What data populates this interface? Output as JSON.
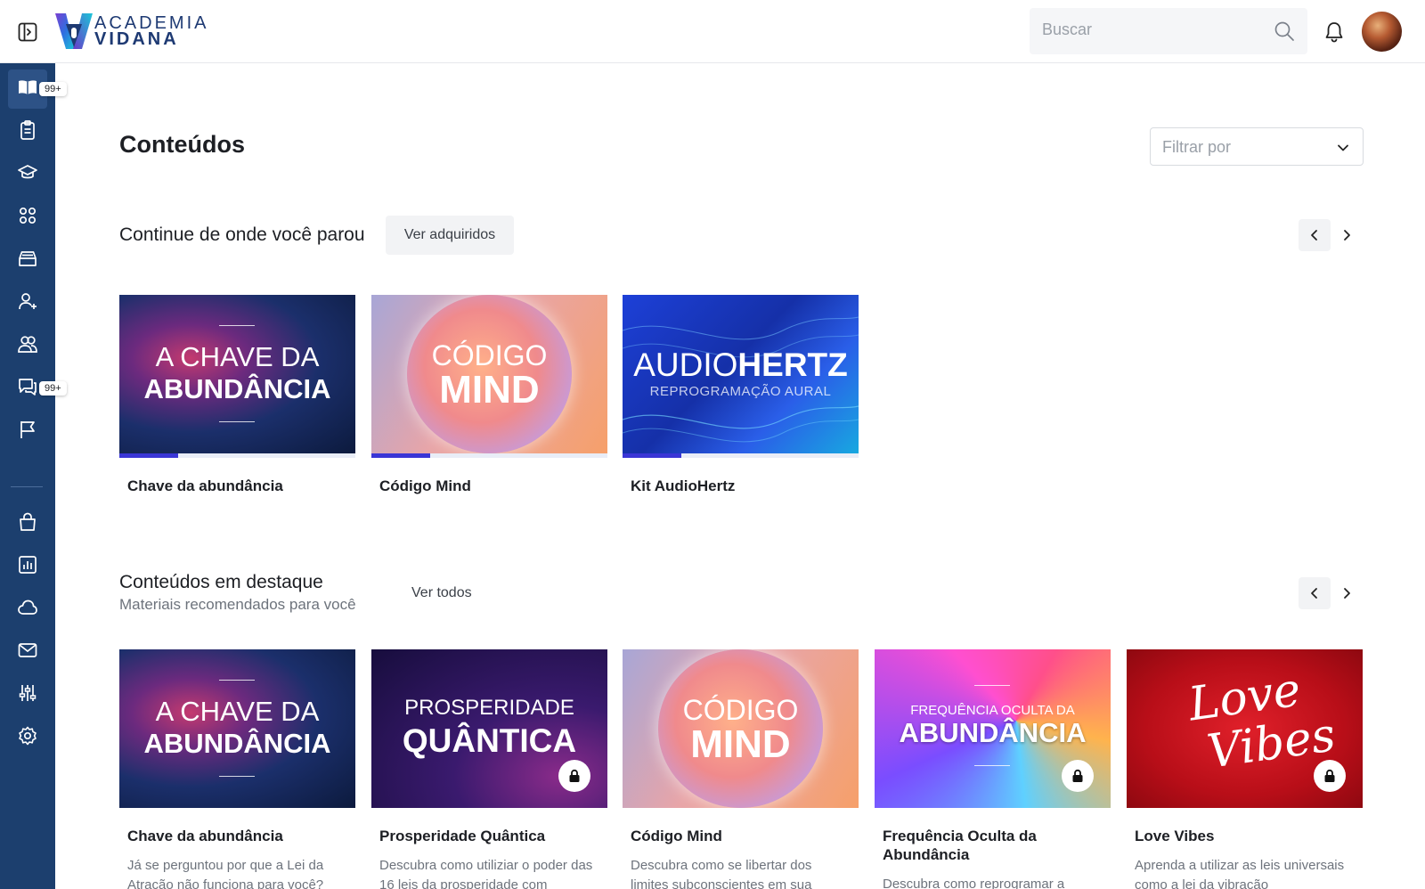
{
  "header": {
    "logo_line1": "ACADEMIA",
    "logo_line2": "VIDANA",
    "search_placeholder": "Buscar"
  },
  "sidebar": {
    "badges": {
      "contents": "99+",
      "messages": "99+"
    }
  },
  "main": {
    "title": "Conteúdos",
    "filter_placeholder": "Filtrar por",
    "continue": {
      "title": "Continue de onde você parou",
      "button": "Ver adquiridos",
      "items": [
        {
          "title": "Chave da abundância",
          "progress": 0.25,
          "art_line1": "A CHAVE DA",
          "art_line2": "ABUNDÂNCIA"
        },
        {
          "title": "Código Mind",
          "progress": 0.25,
          "art_line1": "CÓDIGO",
          "art_line2": "MIND"
        },
        {
          "title": "Kit AudioHertz",
          "progress": 0.25,
          "art_line1": "AUDIO",
          "art_line1b": "HERTZ",
          "art_line2": "REPROGRAMAÇÃO AURAL"
        }
      ]
    },
    "featured": {
      "title": "Conteúdos em destaque",
      "subtitle": "Materiais recomendados para você",
      "button": "Ver todos",
      "items": [
        {
          "title": "Chave da abundância",
          "desc": "Já se perguntou por que a Lei da Atração não funciona para você?",
          "locked": false,
          "art_line1": "A CHAVE DA",
          "art_line2": "ABUNDÂNCIA"
        },
        {
          "title": "Prosperidade Quântica",
          "desc": "Descubra como utiliziar o poder das 16 leis da prosperidade com",
          "locked": true,
          "art_line1": "PROSPERIDADE",
          "art_line2": "QUÂNTICA"
        },
        {
          "title": "Código Mind",
          "desc": "Descubra como se libertar dos limites subconscientes em sua",
          "locked": false,
          "art_line1": "CÓDIGO",
          "art_line2": "MIND"
        },
        {
          "title": "Frequência Oculta da Abundância",
          "desc": "Descubra como reprogramar a",
          "locked": true,
          "art_line1": "FREQUÊNCIA OCULTA DA",
          "art_line2": "ABUNDÂNCIA"
        },
        {
          "title": "Love Vibes",
          "desc": "Aprenda a utilizar as leis universais como a lei da vibração",
          "locked": true,
          "art_line1": "Love",
          "art_line2": "Vibes"
        }
      ]
    }
  },
  "icons": {
    "sidebar": [
      "book-open-icon",
      "clipboard-icon",
      "graduation-cap-icon",
      "apps-grid-icon",
      "inbox-tray-icon",
      "user-plus-icon",
      "users-icon",
      "chat-icon",
      "flag-icon",
      "shopping-bag-icon",
      "bar-chart-icon",
      "cloud-icon",
      "mail-icon",
      "sliders-icon",
      "gear-icon"
    ]
  },
  "colors": {
    "sidebar_bg": "#1c3f6e",
    "sidebar_active": "#2d5286",
    "progress_fill": "#3a36d6",
    "brand_text": "#1e3a73"
  }
}
